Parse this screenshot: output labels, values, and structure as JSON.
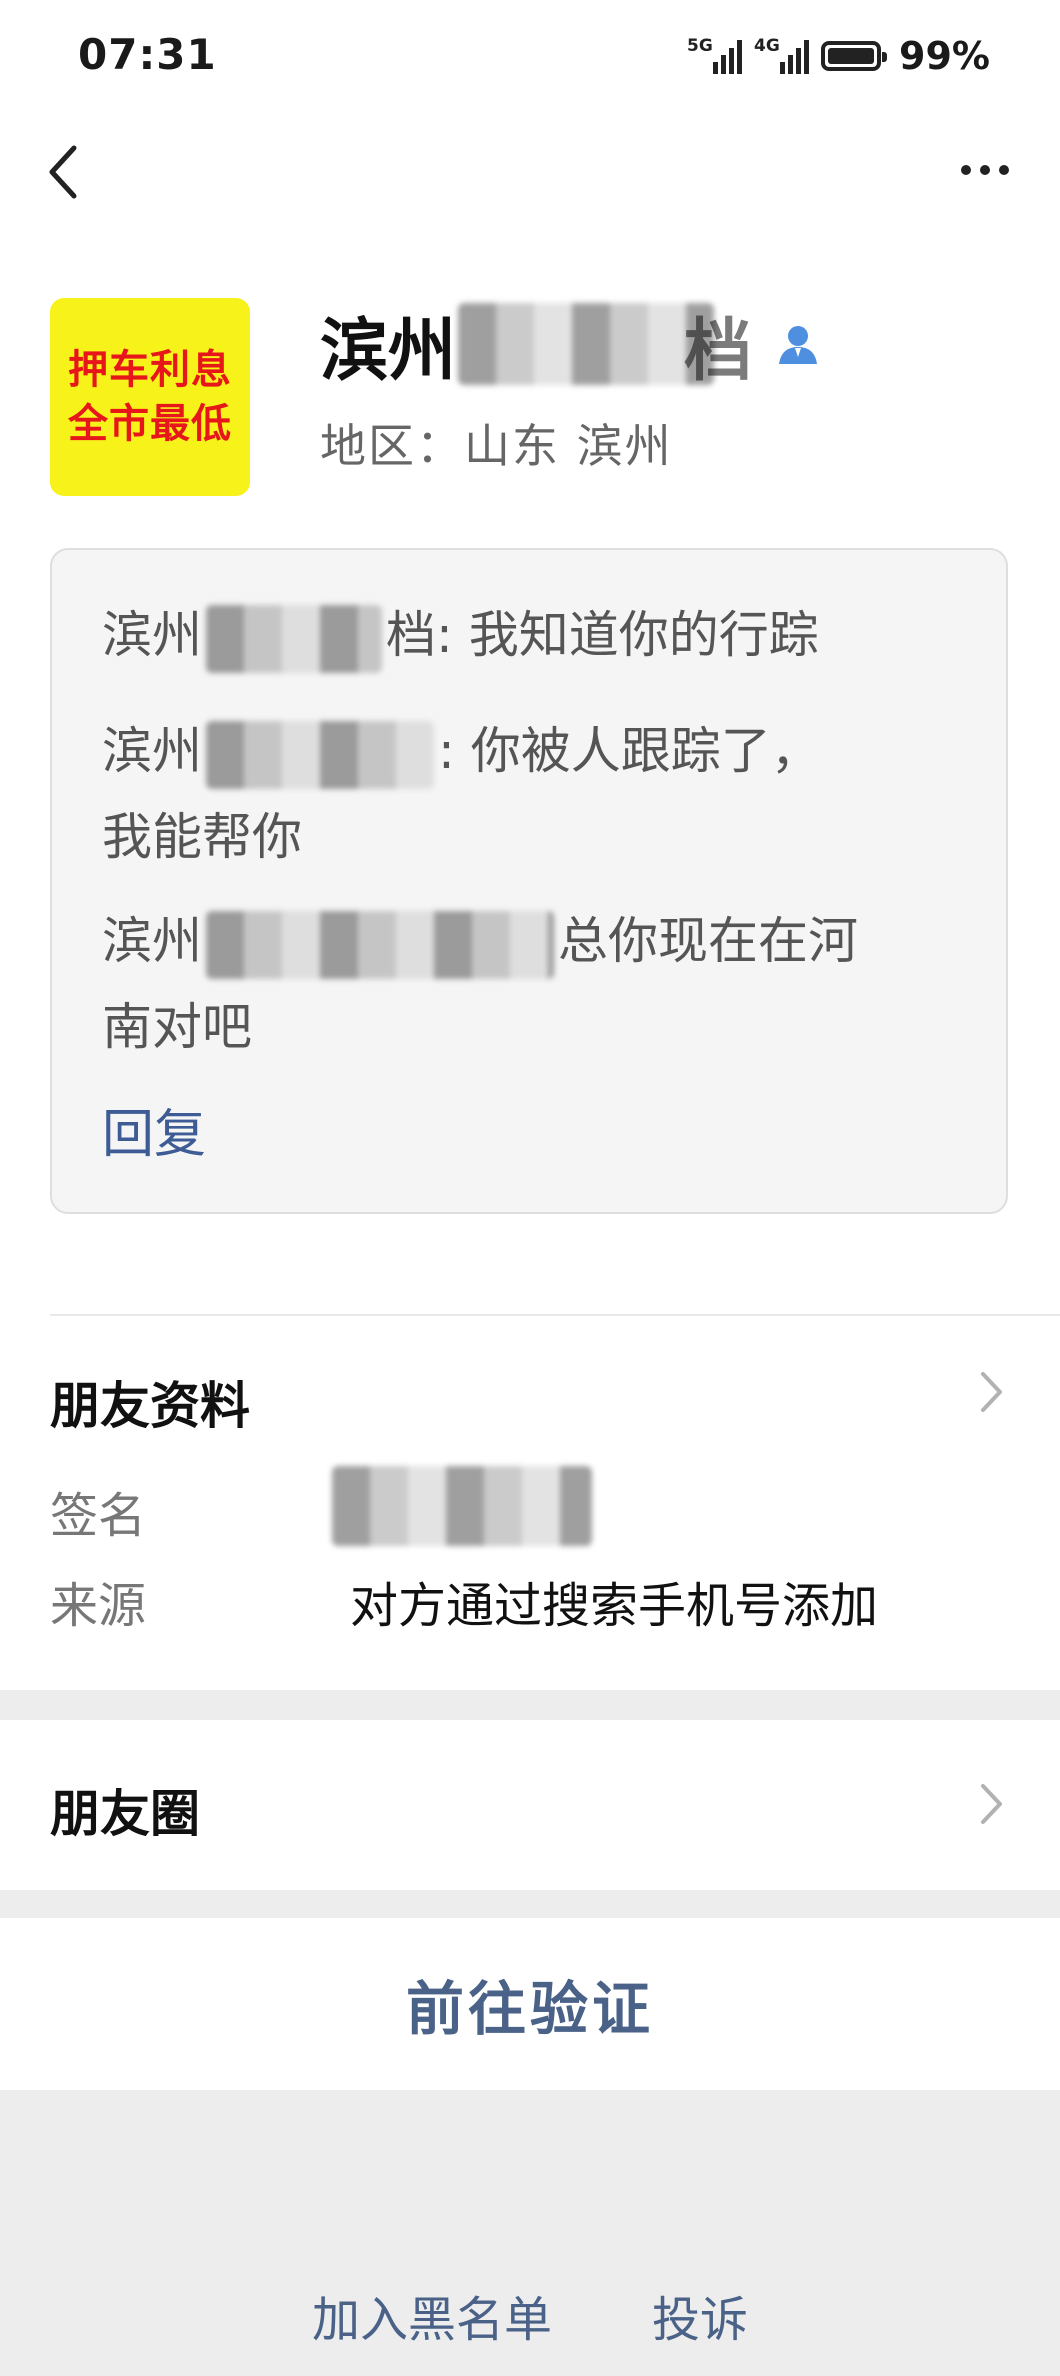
{
  "status_bar": {
    "time": "07:31",
    "net1": "5G",
    "net2": "4G",
    "battery": "99%"
  },
  "nav": {
    "back_icon": "chevron-left-icon",
    "more_icon": "more-horizontal-icon"
  },
  "profile": {
    "avatar_line1": "押车利息",
    "avatar_line2": "全市最低",
    "name_prefix": "滨州",
    "name_suffix": "档",
    "region": "地区：山东 滨州"
  },
  "messages": {
    "items": [
      {
        "sender_prefix": "滨州",
        "sender_suffix": "档",
        "text": ": 我知道你的行踪"
      },
      {
        "sender_prefix": "滨州",
        "text_line1": ": 你被人跟踪了，",
        "text_line2": "我能帮你"
      },
      {
        "sender_prefix": "滨州",
        "text_line1": "总你现在在河",
        "text_line2": "南对吧"
      }
    ],
    "reply_label": "回复"
  },
  "friend_info": {
    "title": "朋友资料",
    "signature_label": "签名",
    "source_label": "来源",
    "source_value": "对方通过搜索手机号添加"
  },
  "moments": {
    "title": "朋友圈"
  },
  "verify": {
    "label": "前往验证"
  },
  "bottom": {
    "blacklist_label": "加入黑名单",
    "report_label": "投诉"
  },
  "colors": {
    "accent": "#4a6288",
    "avatar_bg": "#f7f21a",
    "avatar_text": "#e6161a"
  }
}
